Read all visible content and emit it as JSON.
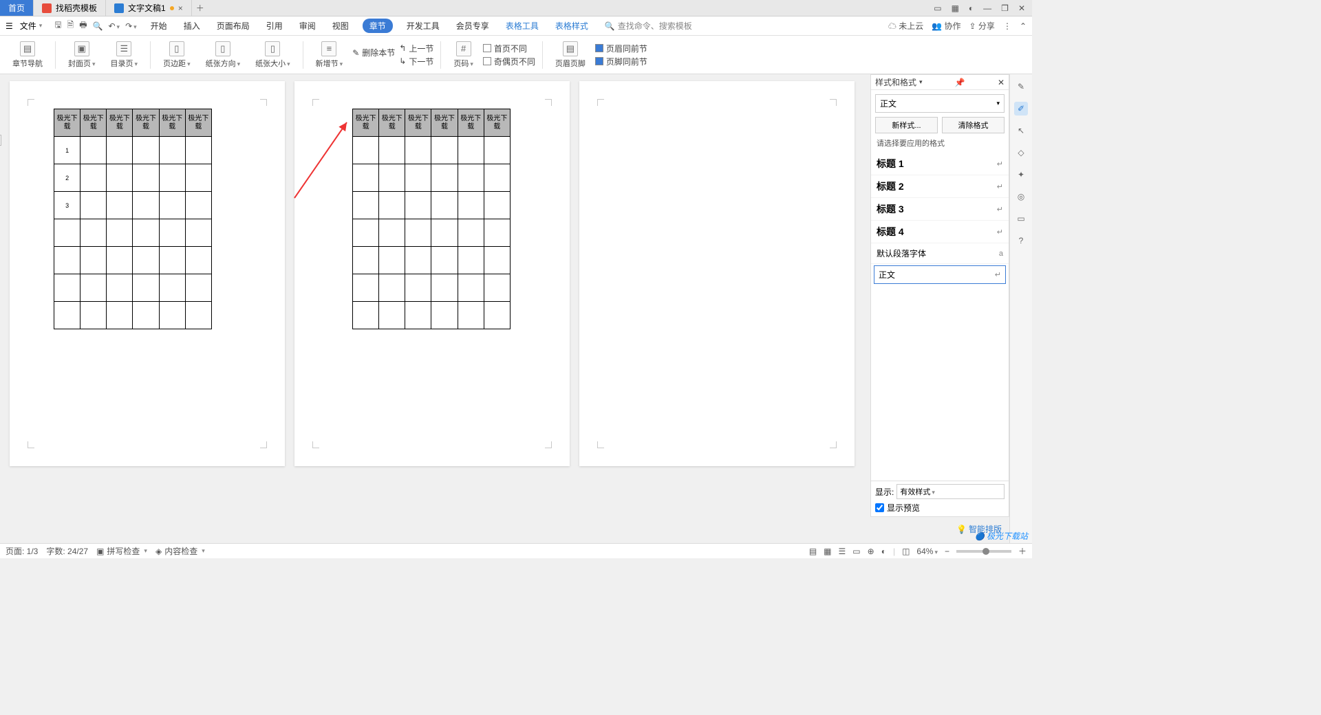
{
  "tabs": {
    "home": "首页",
    "template": "找稻壳模板",
    "doc": "文字文稿1"
  },
  "window": {
    "file": "文件"
  },
  "ribbon_tabs": [
    "开始",
    "插入",
    "页面布局",
    "引用",
    "审阅",
    "视图",
    "章节",
    "开发工具",
    "会员专享"
  ],
  "context_tabs": [
    "表格工具",
    "表格样式"
  ],
  "search_ph": "查找命令、搜索模板",
  "cloud": {
    "unsaved": "未上云",
    "coop": "协作",
    "share": "分享"
  },
  "ribbon": {
    "nav": "章节导航",
    "cover": "封面页",
    "toc": "目录页",
    "margin": "页边距",
    "orient": "纸张方向",
    "size": "纸张大小",
    "newsec": "新增节",
    "delsec": "删除本节",
    "prevsec": "上一节",
    "nextsec": "下一节",
    "pagenum": "页码",
    "diff1": "首页不同",
    "diff2": "奇偶页不同",
    "hf": "页眉页脚",
    "same1": "页眉同前节",
    "same2": "页脚同前节"
  },
  "table_header": "极光下载",
  "rows": [
    "1",
    "2",
    "3"
  ],
  "pane": {
    "title": "样式和格式",
    "current": "正文",
    "new": "新样式...",
    "clear": "清除格式",
    "hint": "请选择要应用的格式",
    "styles": [
      "标题 1",
      "标题 2",
      "标题 3",
      "标题 4"
    ],
    "def": "默认段落字体",
    "body": "正文",
    "show": "显示:",
    "show_val": "有效样式",
    "preview": "显示预览",
    "smart": "智能排版"
  },
  "status": {
    "page": "页面: 1/3",
    "words": "字数: 24/27",
    "spell": "拼写检查",
    "content": "内容检查",
    "zoom": "64%"
  },
  "watermark": "极光下载站"
}
